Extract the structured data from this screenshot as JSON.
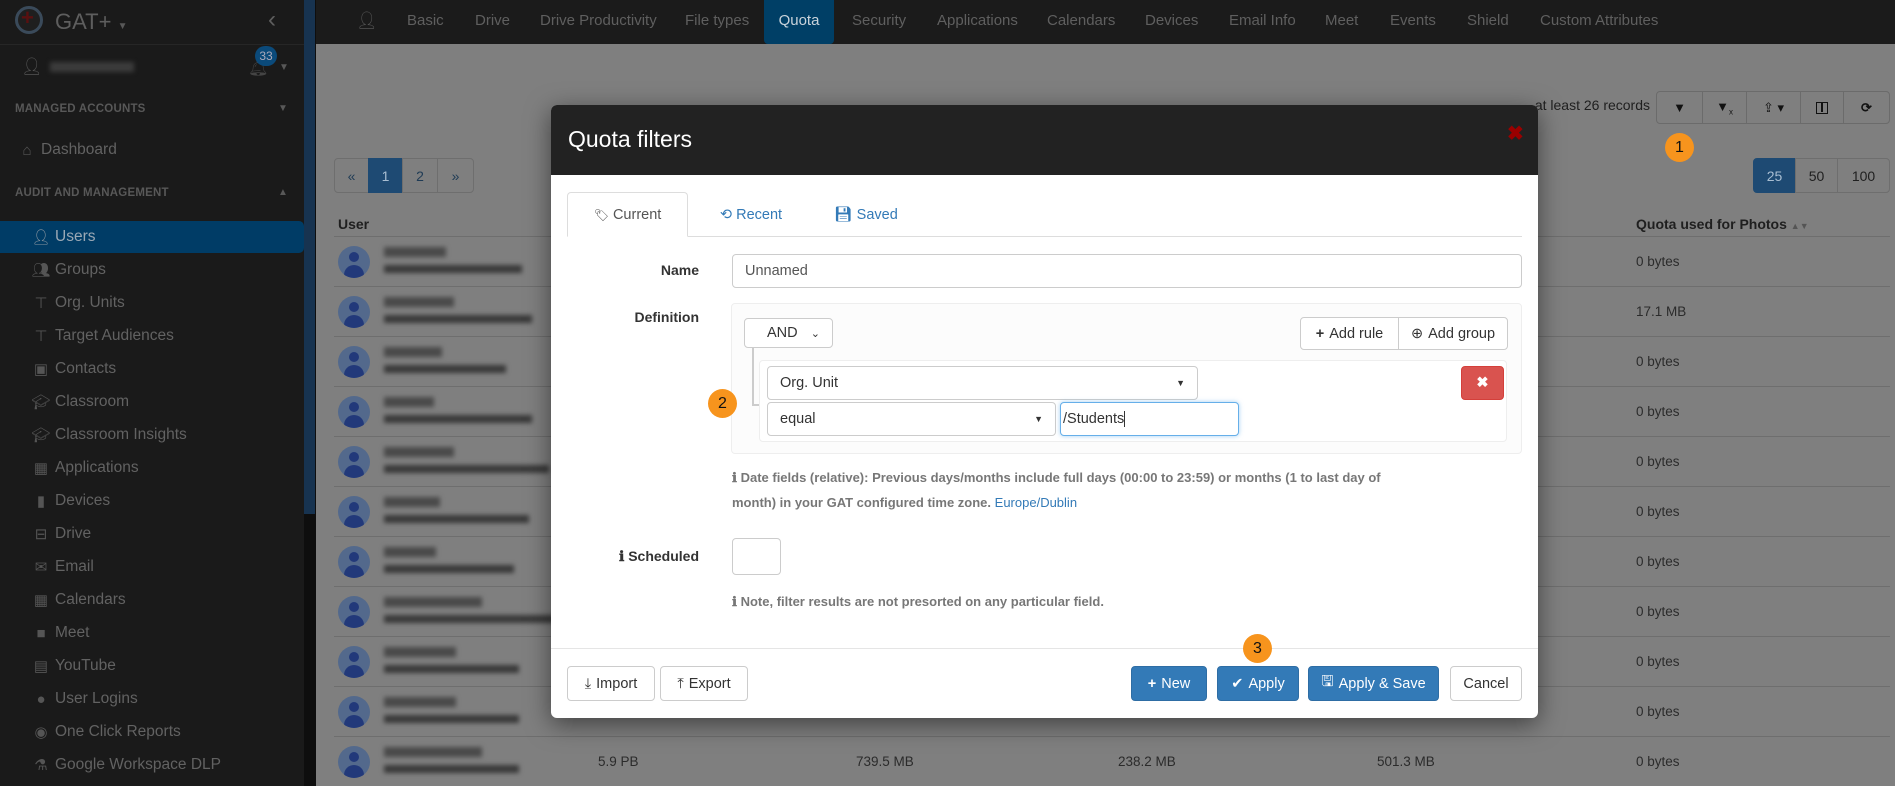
{
  "sidebar": {
    "brand": "GAT+",
    "notification_count": "33",
    "sections": {
      "managed": "MANAGED ACCOUNTS",
      "audit": "AUDIT AND MANAGEMENT"
    },
    "dashboard": "Dashboard",
    "items": [
      {
        "label": "Users",
        "icon": "user-icon",
        "active": true
      },
      {
        "label": "Groups",
        "icon": "users-icon"
      },
      {
        "label": "Org. Units",
        "icon": "sitemap-icon"
      },
      {
        "label": "Target Audiences",
        "icon": "sitemap-icon"
      },
      {
        "label": "Contacts",
        "icon": "address-book-icon"
      },
      {
        "label": "Classroom",
        "icon": "graduation-cap-icon"
      },
      {
        "label": "Classroom Insights",
        "icon": "graduation-cap-search-icon"
      },
      {
        "label": "Applications",
        "icon": "grid-icon"
      },
      {
        "label": "Devices",
        "icon": "device-icon"
      },
      {
        "label": "Drive",
        "icon": "hdd-icon"
      },
      {
        "label": "Email",
        "icon": "envelope-icon"
      },
      {
        "label": "Calendars",
        "icon": "calendar-icon"
      },
      {
        "label": "Meet",
        "icon": "video-camera-icon"
      },
      {
        "label": "YouTube",
        "icon": "film-icon"
      },
      {
        "label": "User Logins",
        "icon": "globe-icon"
      },
      {
        "label": "One Click Reports",
        "icon": "eye-icon"
      },
      {
        "label": "Google Workspace DLP",
        "icon": "flask-icon"
      }
    ]
  },
  "topnav": {
    "tabs": [
      "Basic",
      "Drive",
      "Drive Productivity",
      "File types",
      "Quota",
      "Security",
      "Applications",
      "Calendars",
      "Devices",
      "Email Info",
      "Meet",
      "Events",
      "Shield",
      "Custom Attributes"
    ],
    "active": "Quota"
  },
  "toolbar": {
    "records": "at least 26 records",
    "buttons": [
      "filter-icon",
      "clear-filter-icon",
      "export-icon",
      "columns-icon",
      "refresh-icon"
    ]
  },
  "pagination": {
    "prev": "«",
    "pages": [
      "1",
      "2"
    ],
    "next": "»",
    "current": "1"
  },
  "page_size": {
    "options": [
      "25",
      "50",
      "100"
    ],
    "selected": "25"
  },
  "table": {
    "headers": {
      "user": "User",
      "photos": "Quota used for Photos"
    },
    "photos": [
      "0 bytes",
      "17.1 MB",
      "0 bytes",
      "0 bytes",
      "0 bytes",
      "0 bytes",
      "0 bytes",
      "0 bytes",
      "0 bytes",
      "0 bytes",
      "0 bytes"
    ],
    "last_row": [
      "5.9 PB",
      "739.5 MB",
      "238.2 MB",
      "501.3 MB"
    ]
  },
  "modal": {
    "title": "Quota filters",
    "tabs": [
      "Current",
      "Recent",
      "Saved"
    ],
    "name_label": "Name",
    "name_value": "Unnamed",
    "definition_label": "Definition",
    "condition": "AND",
    "add_rule": "Add rule",
    "add_group": "Add group",
    "rule_field": "Org. Unit",
    "rule_operator": "equal",
    "rule_value": "/Students",
    "date_info": "Date fields (relative): Previous days/months include full days (00:00 to 23:59) or months (1 to last day of month) in your GAT configured time zone.",
    "timezone": "Europe/Dublin",
    "scheduled_label": "Scheduled",
    "note": "Note, filter results are not presorted on any particular field.",
    "buttons": {
      "import": "Import",
      "export": "Export",
      "new": "New",
      "apply": "Apply",
      "apply_save": "Apply & Save",
      "cancel": "Cancel"
    }
  },
  "callouts": [
    "1",
    "2",
    "3"
  ],
  "colors": {
    "accent": "#337ab7",
    "danger": "#d9534f",
    "callout": "#f7941d",
    "modal_header": "#222222"
  }
}
